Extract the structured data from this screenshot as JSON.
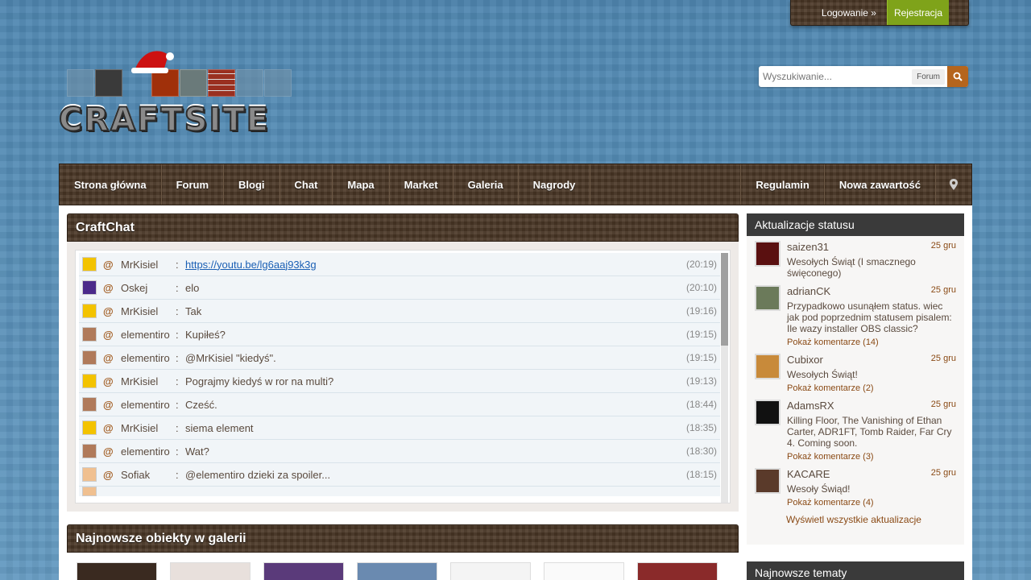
{
  "user_bar": {
    "login": "Logowanie »",
    "register": "Rejestracja"
  },
  "logo": {
    "text": "CRAFTSITE"
  },
  "search": {
    "placeholder": "Wyszukiwanie...",
    "scope": "Forum"
  },
  "nav": {
    "left": [
      "Strona główna",
      "Forum",
      "Blogi",
      "Chat",
      "Mapa",
      "Market",
      "Galeria",
      "Nagrody"
    ],
    "right": [
      "Regulamin",
      "Nowa zawartość"
    ]
  },
  "chat": {
    "title": "CraftChat",
    "messages": [
      {
        "nick": "MrKisiel",
        "msg": "https://youtu.be/lg6aaj93k3g",
        "time": "(20:19)",
        "av": "#f3c300"
      },
      {
        "nick": "Oskej",
        "msg": "elo",
        "time": "(20:10)",
        "av": "#4b2a8a"
      },
      {
        "nick": "MrKisiel",
        "msg": "Tak",
        "time": "(19:16)",
        "av": "#f3c300"
      },
      {
        "nick": "elementiro",
        "msg": "Kupiłeś?",
        "time": "(19:15)",
        "av": "#b07a5a"
      },
      {
        "nick": "elementiro",
        "msg": "@MrKisiel \"kiedyś\".",
        "time": "(19:15)",
        "av": "#b07a5a"
      },
      {
        "nick": "MrKisiel",
        "msg": "Pograjmy kiedyś w ror na multi?",
        "time": "(19:13)",
        "av": "#f3c300"
      },
      {
        "nick": "elementiro",
        "msg": "Cześć.",
        "time": "(18:44)",
        "av": "#b07a5a"
      },
      {
        "nick": "MrKisiel",
        "msg": "siema element",
        "time": "(18:35)",
        "av": "#f3c300"
      },
      {
        "nick": "elementiro",
        "msg": "Wat?",
        "time": "(18:30)",
        "av": "#b07a5a"
      },
      {
        "nick": "Sofiak",
        "msg": "@elementiro dzieki za spoiler...",
        "time": "(18:15)",
        "av": "#f0c090"
      }
    ],
    "at_symbol": "@",
    "colon": ":"
  },
  "gallery": {
    "title": "Najnowsze obiekty w galerii"
  },
  "status": {
    "title": "Aktualizacje statusu",
    "items": [
      {
        "name": "saizen31",
        "date": "25 gru",
        "text": "Wesołych Świąt (I smacznego święconego)",
        "comments": "",
        "av": "#5a1010"
      },
      {
        "name": "adrianCK",
        "date": "25 gru",
        "text": "Przypadkowo usunąłem status. wiec jak pod poprzednim statusem pisalem: Ile wazy installer OBS classic?",
        "comments": "Pokaż komentarze (14)",
        "av": "#6b7a5a"
      },
      {
        "name": "Cubixor",
        "date": "25 gru",
        "text": "Wesołych Świąt!",
        "comments": "Pokaż komentarze (2)",
        "av": "#c88a3a"
      },
      {
        "name": "AdamsRX",
        "date": "25 gru",
        "text": "Killing Floor, The Vanishing of Ethan Carter, ADR1FT, Tomb Raider, Far Cry 4. Coming soon.",
        "comments": "Pokaż komentarze (3)",
        "av": "#111111"
      },
      {
        "name": "KACARE",
        "date": "25 gru",
        "text": "Wesoły Świąd!",
        "comments": "Pokaż komentarze (4)",
        "av": "#5a3a2a"
      }
    ],
    "show_all": "Wyświetl wszystkie aktualizacje"
  },
  "topics": {
    "title": "Najnowsze tematy"
  }
}
